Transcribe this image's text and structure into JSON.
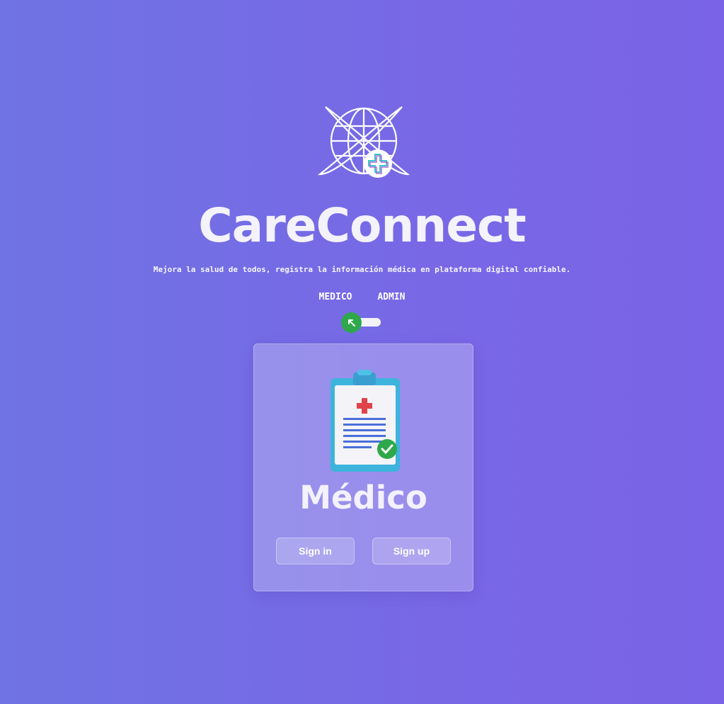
{
  "app": {
    "title": "CareConnect",
    "tagline": "Mejora la salud de todos, registra la información médica en plataforma digital confiable."
  },
  "roles": {
    "medico": "MEDICO",
    "admin": "ADMIN"
  },
  "toggle": {
    "state": "medico"
  },
  "card": {
    "title": "Médico",
    "sign_in": "Sign in",
    "sign_up": "Sign up"
  },
  "colors": {
    "background_start": "#6f73e3",
    "background_end": "#7a63e6",
    "toggle_knob": "#2ea84a"
  },
  "icons": {
    "logo": "globe-plus-icon",
    "toggle": "arrow-up-left-icon",
    "card": "medical-clipboard-icon"
  }
}
